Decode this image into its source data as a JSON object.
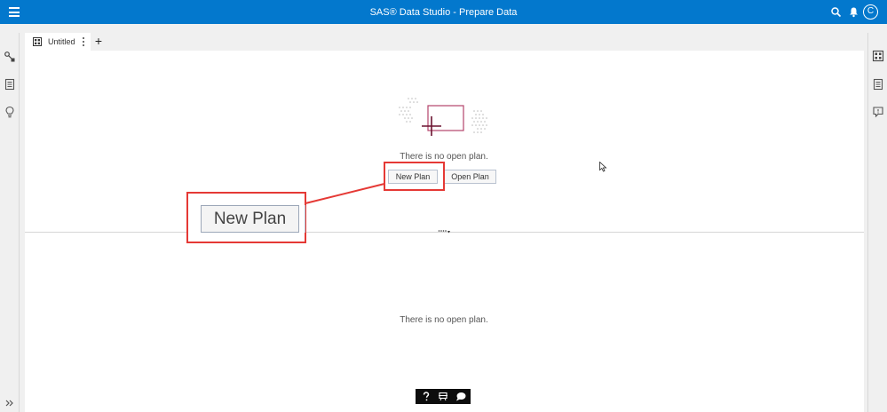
{
  "header": {
    "title": "SAS® Data Studio - Prepare Data",
    "avatar_initial": "C",
    "background_color": "#0378cd"
  },
  "tabs": [
    {
      "label": "Untitled"
    }
  ],
  "top_pane": {
    "message": "There is no open plan.",
    "new_plan_label": "New Plan",
    "open_plan_label": "Open Plan"
  },
  "bottom_pane": {
    "message": "There is no open plan."
  },
  "callout": {
    "zoomed_label": "New Plan",
    "highlight_color": "#e53935"
  },
  "icons": {
    "top_right": [
      "search-icon",
      "bell-icon"
    ],
    "left_rail": [
      "data-sources-icon",
      "document-icon",
      "lightbulb-icon",
      "expand-icon"
    ],
    "right_rail": [
      "grid-icon",
      "document-icon",
      "comment-icon"
    ],
    "help_bar": [
      "help-icon",
      "settings-toggle-icon",
      "chat-icon"
    ]
  }
}
